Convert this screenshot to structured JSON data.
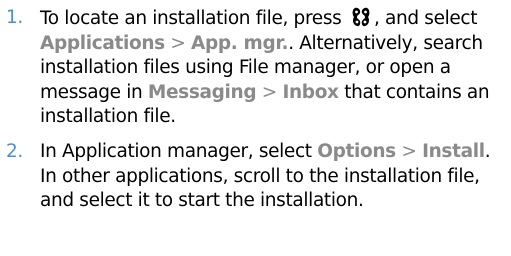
{
  "steps": [
    {
      "number": "1.",
      "t1": "To locate an installation file, press",
      "t2": ", and select",
      "ui1": "Applications",
      "sep1": ">",
      "ui2": "App. mgr.",
      "t3": ". Alternatively, search installation files using File manager, or open a message in",
      "ui3": "Messaging",
      "sep2": ">",
      "ui4": "Inbox",
      "t4": "that contains an installation file."
    },
    {
      "number": "2.",
      "t1": "In Application manager, select",
      "ui1": "Options",
      "sep1": ">",
      "ui2": "Install",
      "t2": ". In other applications, scroll to the installation file, and select it to start the installation."
    }
  ],
  "icons": {
    "menu_key": "menu-key-icon"
  },
  "colors": {
    "step_number": "#4a8fd6",
    "ui_term": "#8a8a8a",
    "text": "#000000"
  }
}
